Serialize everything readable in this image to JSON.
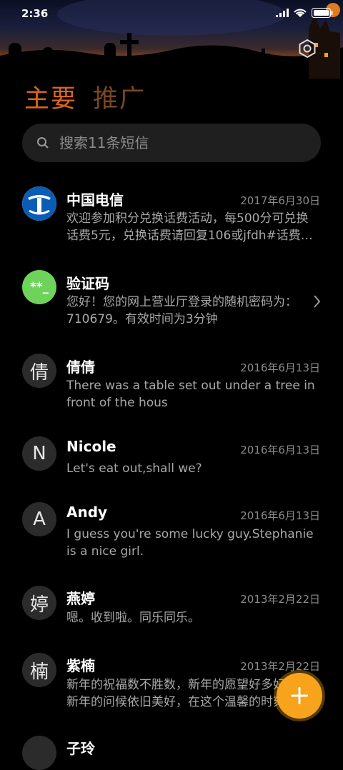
{
  "status_bar": {
    "time": "2:36"
  },
  "tabs": [
    {
      "label": "主要"
    },
    {
      "label": "推广"
    }
  ],
  "search": {
    "placeholder": "搜索11条短信"
  },
  "colors": {
    "accent": "#d9651c",
    "fab": "#f7a31b",
    "verify_avatar": "#6dd35b",
    "telecom_blue": "#0a5db6"
  },
  "conversations": [
    {
      "name": "中国电信",
      "date": "2017年6月30日",
      "preview": "欢迎参加积分兑换话费活动，每500分可兑换话费5元，兑换话费请回复106或jfdh#话费…",
      "avatar": "china-telecom-logo-icon"
    },
    {
      "name": "验证码",
      "date": "",
      "preview": "您好！您的网上营业厅登录的随机密码为：710679。有效时间为3分钟",
      "avatar_text": "**_"
    },
    {
      "name": "倩倩",
      "date": "2016年6月13日",
      "preview": "There was a table set out under a tree in front of the hous",
      "avatar_text": "倩"
    },
    {
      "name": "Nicole",
      "date": "2016年6月13日",
      "preview": "Let's eat out,shall we?",
      "avatar_text": "N"
    },
    {
      "name": "Andy",
      "date": "2016年6月13日",
      "preview": "I guess you're some lucky guy.Stephanie is a nice girl.",
      "avatar_text": "A"
    },
    {
      "name": "燕婷",
      "date": "2013年2月22日",
      "preview": "嗯。收到啦。同乐同乐。",
      "avatar_text": "婷"
    },
    {
      "name": "紫楠",
      "date": "2013年2月22日",
      "preview": "新年的祝福数不胜数，新年的愿望好多好多，新年的问候依旧美好，在这个温馨的时刻",
      "avatar_text": "楠"
    },
    {
      "name": "子玲",
      "date": "",
      "preview": "",
      "avatar_text": ""
    }
  ],
  "fab": {
    "icon": "plus-icon"
  }
}
